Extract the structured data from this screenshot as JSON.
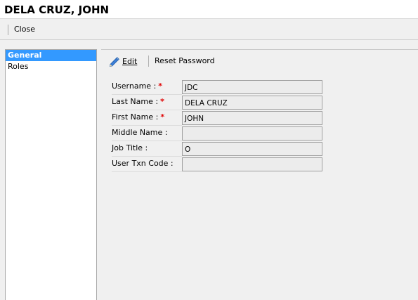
{
  "window": {
    "title": "DELA CRUZ, JOHN"
  },
  "toolbar": {
    "close_label": "Close"
  },
  "nav": {
    "items": [
      {
        "label": "General",
        "selected": true
      },
      {
        "label": "Roles",
        "selected": false
      }
    ]
  },
  "actions": {
    "edit_label": "Edit",
    "reset_password_label": "Reset Password"
  },
  "form": {
    "required_marker": "*",
    "fields": [
      {
        "label": "Username :",
        "value": "JDC",
        "required": true
      },
      {
        "label": "Last Name :",
        "value": "DELA CRUZ",
        "required": true
      },
      {
        "label": "First Name :",
        "value": "JOHN",
        "required": true
      },
      {
        "label": "Middle Name :",
        "value": "",
        "required": false
      },
      {
        "label": "Job Title :",
        "value": "O",
        "required": false
      },
      {
        "label": "User Txn Code :",
        "value": "",
        "required": false
      }
    ]
  },
  "colors": {
    "selection": "#3399ff",
    "required": "#e00000",
    "input_bg": "#ececec"
  },
  "icons": {
    "edit": "pencil-icon"
  }
}
